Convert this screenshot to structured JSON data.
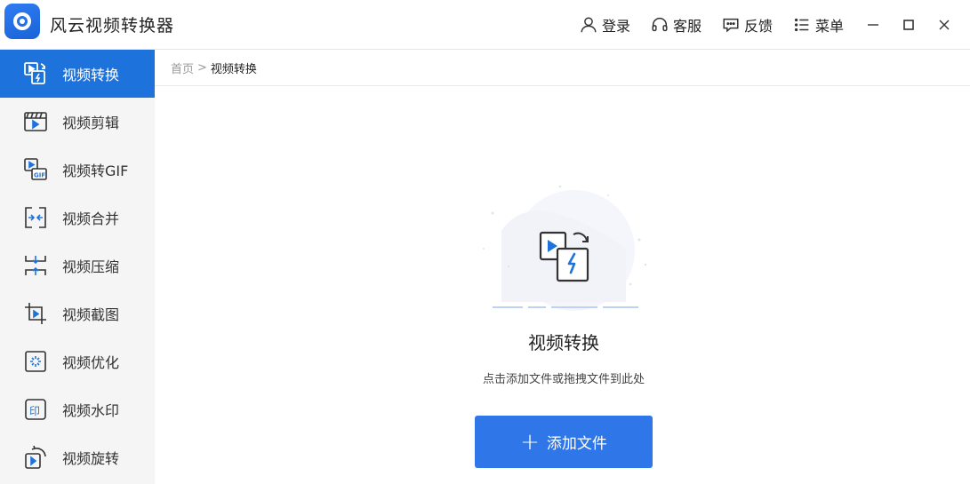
{
  "app": {
    "title": "风云视频转换器"
  },
  "header": {
    "login": "登录",
    "service": "客服",
    "feedback": "反馈",
    "menu": "菜单"
  },
  "sidebar": {
    "items": [
      {
        "label": "视频转换",
        "icon": "video-convert-icon",
        "active": true
      },
      {
        "label": "视频剪辑",
        "icon": "video-edit-icon"
      },
      {
        "label": "视频转GIF",
        "icon": "video-gif-icon"
      },
      {
        "label": "视频合并",
        "icon": "video-merge-icon"
      },
      {
        "label": "视频压缩",
        "icon": "video-compress-icon"
      },
      {
        "label": "视频截图",
        "icon": "video-crop-icon"
      },
      {
        "label": "视频优化",
        "icon": "video-optimize-icon"
      },
      {
        "label": "视频水印",
        "icon": "video-watermark-icon"
      },
      {
        "label": "视频旋转",
        "icon": "video-rotate-icon"
      }
    ]
  },
  "breadcrumb": {
    "home": "首页",
    "separator": ">",
    "current": "视频转换"
  },
  "main": {
    "title": "视频转换",
    "description": "点击添加文件或拖拽文件到此处",
    "add_button": "添加文件"
  },
  "colors": {
    "accent": "#1e72dc",
    "button": "#2f76e8",
    "sidebar_bg": "#f5f5f5"
  }
}
